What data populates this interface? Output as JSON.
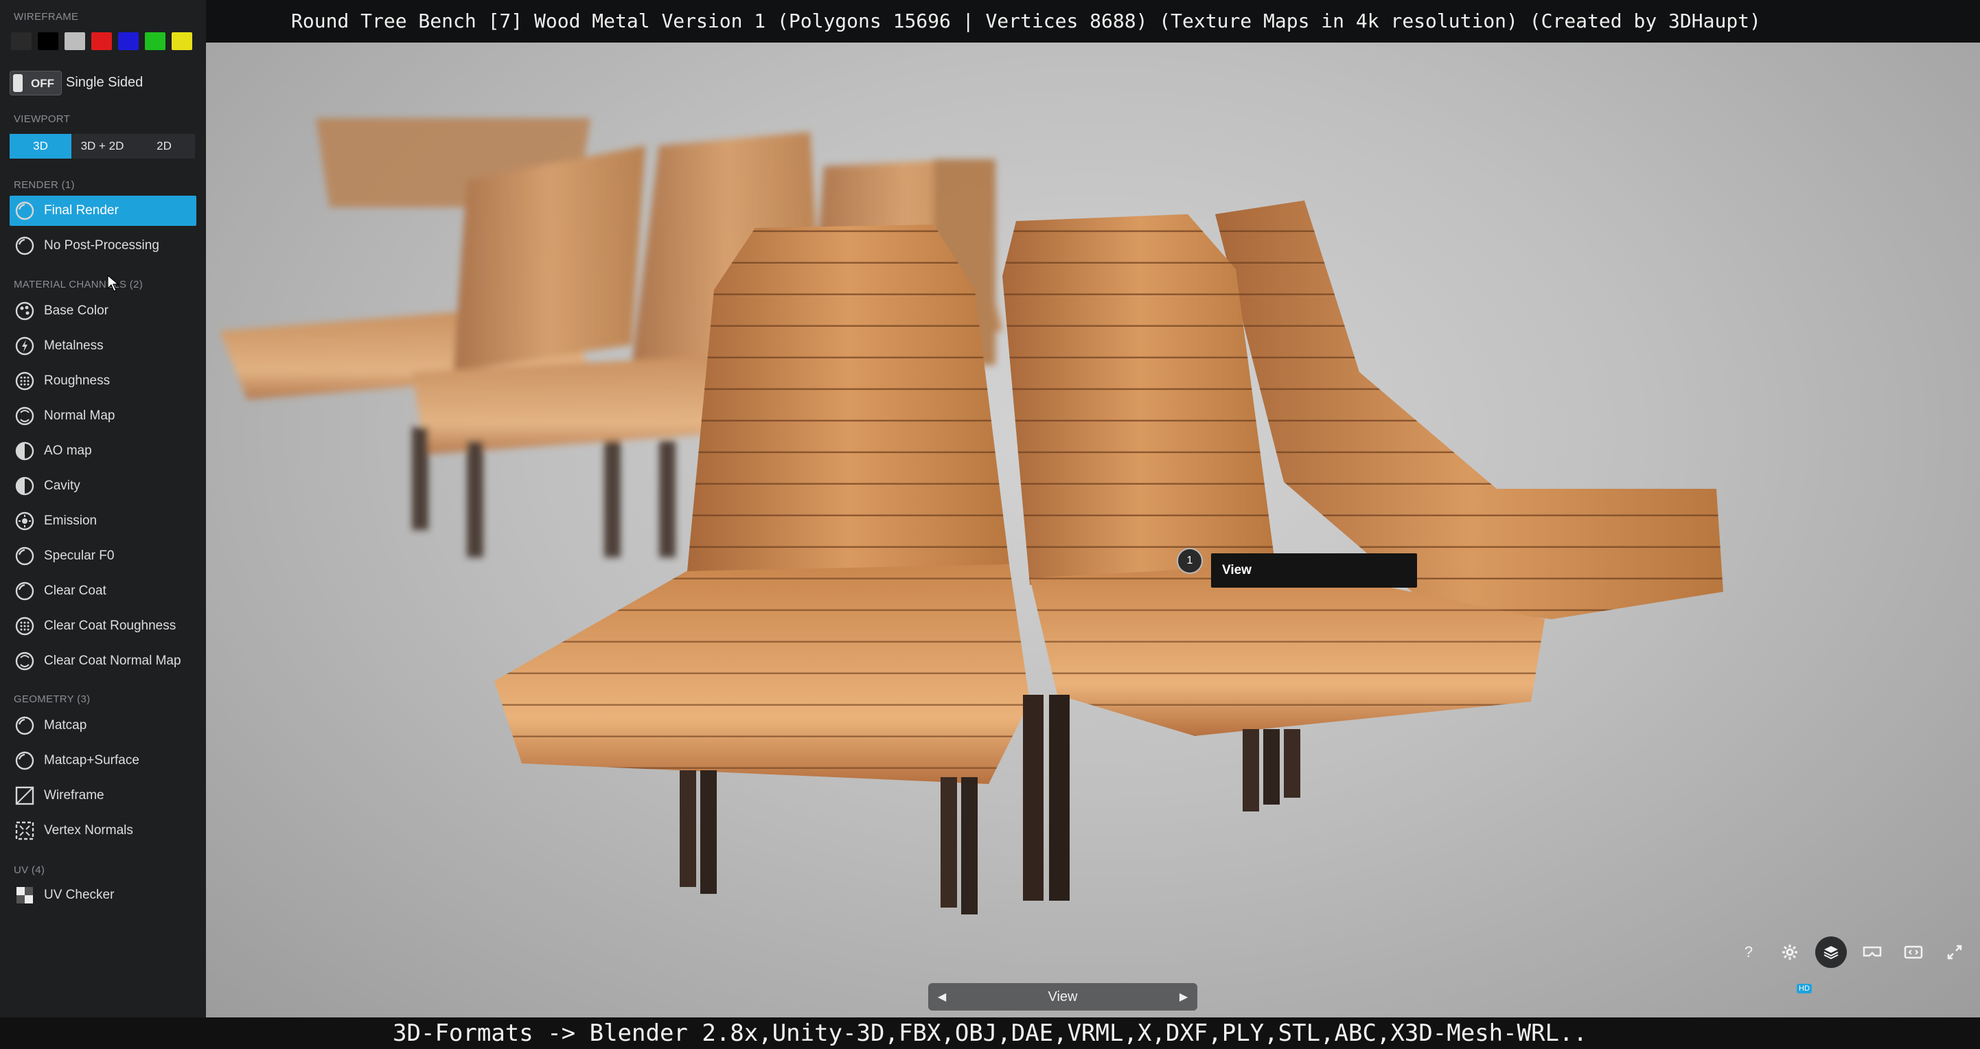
{
  "window": {
    "title": "Round Tree Bench [7] Wood Metal Version 1 (Polygons 15696 | Vertices 8688) (Texture Maps in 4k resolution) (Created by 3DHaupt)"
  },
  "sidebar": {
    "wireframe_label": "WIREFRAME",
    "wireframe_swatches": [
      "#2a2a2a",
      "#000000",
      "#bdbdbd",
      "#e01b1b",
      "#1d1bd8",
      "#1fbf1f",
      "#e6df17"
    ],
    "toggle": {
      "state": "OFF",
      "label": "Single Sided"
    },
    "viewport_label": "VIEWPORT",
    "viewport_options": [
      "3D",
      "3D + 2D",
      "2D"
    ],
    "viewport_selected": "3D",
    "render_label": "RENDER (1)",
    "render_items": [
      {
        "label": "Final Render",
        "icon": "sphere-icon",
        "active": true
      },
      {
        "label": "No Post-Processing",
        "icon": "sphere-icon",
        "active": false
      }
    ],
    "material_label": "MATERIAL CHANNELS (2)",
    "material_items": [
      {
        "label": "Base Color",
        "icon": "palette-icon"
      },
      {
        "label": "Metalness",
        "icon": "lightning-icon"
      },
      {
        "label": "Roughness",
        "icon": "dots-icon"
      },
      {
        "label": "Normal Map",
        "icon": "normal-map-icon"
      },
      {
        "label": "AO map",
        "icon": "half-circle-icon"
      },
      {
        "label": "Cavity",
        "icon": "half-circle-icon"
      },
      {
        "label": "Emission",
        "icon": "sun-icon"
      },
      {
        "label": "Specular F0",
        "icon": "sphere-icon"
      },
      {
        "label": "Clear Coat",
        "icon": "sphere-icon"
      },
      {
        "label": "Clear Coat Roughness",
        "icon": "dots-icon"
      },
      {
        "label": "Clear Coat Normal Map",
        "icon": "normal-map-icon"
      }
    ],
    "geometry_label": "GEOMETRY (3)",
    "geometry_items": [
      {
        "label": "Matcap",
        "icon": "sphere-icon"
      },
      {
        "label": "Matcap+Surface",
        "icon": "sphere-icon"
      },
      {
        "label": "Wireframe",
        "icon": "wireframe-icon"
      },
      {
        "label": "Vertex Normals",
        "icon": "normals-icon"
      }
    ],
    "uv_label": "UV (4)",
    "uv_items": [
      {
        "label": "UV Checker",
        "icon": "checker-icon"
      }
    ]
  },
  "viewport": {
    "hotspot_number": "1",
    "tooltip_label": "View",
    "nav_label": "View",
    "toolbar_icons": [
      "help-icon",
      "settings-icon",
      "layers-icon",
      "vr-icon",
      "embed-icon",
      "fullscreen-icon"
    ],
    "help_label": "?",
    "hd_badge": "HD"
  },
  "banner": {
    "text": "3D-Formats -> Blender 2.8x,Unity-3D,FBX,OBJ,DAE,VRML,X,DXF,PLY,STL,ABC,X3D-Mesh-WRL.."
  },
  "colors": {
    "accent": "#1ea2dc",
    "sidebar_bg": "#1e1f21",
    "wood": "#c98a52"
  }
}
